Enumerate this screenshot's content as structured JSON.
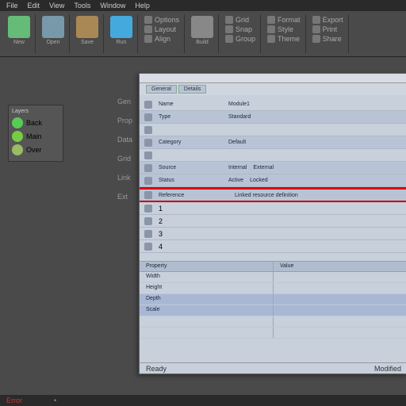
{
  "menu": [
    "File",
    "Edit",
    "View",
    "Tools",
    "Window",
    "Help"
  ],
  "ribbon": [
    {
      "label": "New",
      "icon": "#6b7"
    },
    {
      "label": "Open",
      "icon": "#79a"
    },
    {
      "label": "Save",
      "icon": "#a85"
    },
    {
      "label": "Run",
      "icon": "#4ad"
    },
    {
      "label": "Build",
      "icon": "#888"
    }
  ],
  "ribbonSmall": [
    [
      "Options",
      "Layout",
      "Align"
    ],
    [
      "Grid",
      "Snap",
      "Group"
    ],
    [
      "Format",
      "Style",
      "Theme"
    ],
    [
      "Export",
      "Print",
      "Share"
    ]
  ],
  "sidePanel": {
    "title": "Layers",
    "items": [
      {
        "label": "Back",
        "color": "#5c5"
      },
      {
        "label": "Main",
        "color": "#7c4"
      },
      {
        "label": "Over",
        "color": "#9b6"
      }
    ]
  },
  "gutter": [
    "Gen",
    "Prop",
    "Data",
    "Grid",
    "Link",
    "Ext"
  ],
  "doc": {
    "tabs": [
      "General",
      "Details"
    ],
    "rows": [
      {
        "label": "Name",
        "val": "Module1",
        "alt": false
      },
      {
        "label": "Type",
        "val": "Standard",
        "alt": true
      },
      {
        "label": "",
        "val": "",
        "alt": false
      },
      {
        "label": "Category",
        "val": "Default",
        "alt": true
      },
      {
        "label": "",
        "val": "",
        "alt": false
      },
      {
        "label": "Source",
        "val": "Internal",
        "val2": "External",
        "alt": true
      },
      {
        "label": "Status",
        "val": "Active",
        "val2": "Locked",
        "alt": true
      },
      {
        "label": "Reference",
        "val": "",
        "val2": "Linked resource definition",
        "alt": true,
        "red": true
      }
    ],
    "sideRows": [
      "1",
      "2",
      "3",
      "4"
    ],
    "grid": {
      "headers": [
        "Property",
        "Value"
      ],
      "rows": [
        {
          "c1": "Width",
          "c2": ""
        },
        {
          "c1": "Height",
          "c2": ""
        },
        {
          "c1": "Depth",
          "c2": "",
          "sel": true
        },
        {
          "c1": "Scale",
          "c2": "",
          "sel": true
        },
        {
          "c1": "",
          "c2": ""
        },
        {
          "c1": "",
          "c2": ""
        }
      ]
    },
    "footer": {
      "left": "Ready",
      "right": "Modified"
    }
  },
  "status": {
    "left": "Error",
    "center": "•"
  }
}
